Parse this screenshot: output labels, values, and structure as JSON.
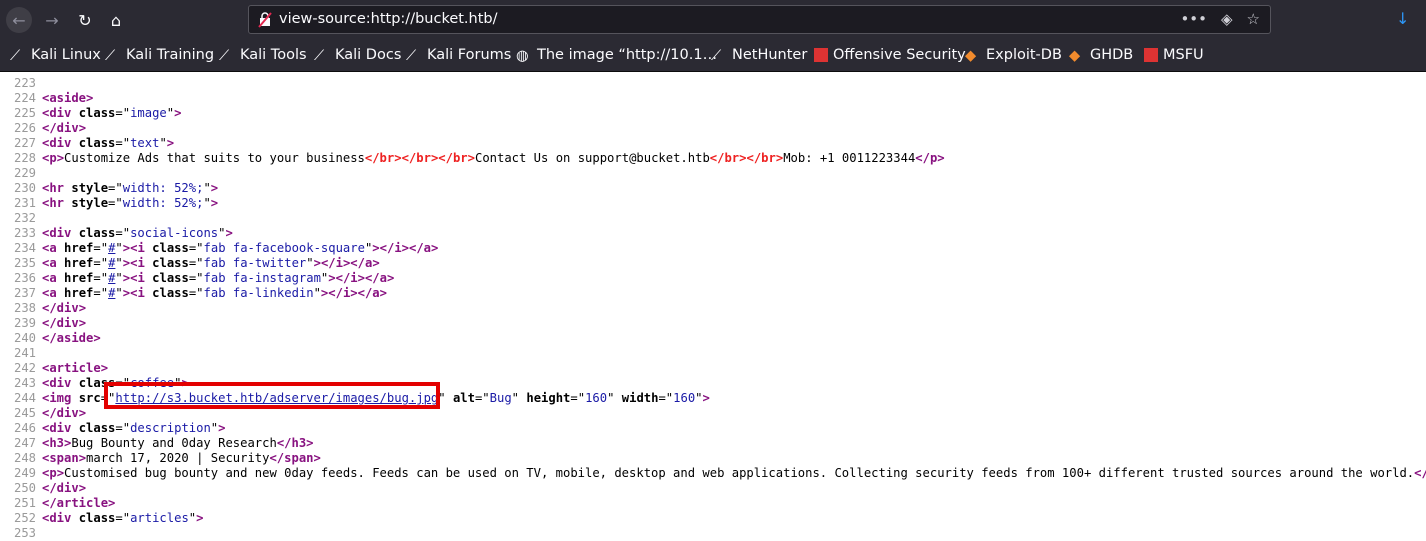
{
  "browser": {
    "url": "view-source:http://bucket.htb/",
    "bookmarks": [
      "Kali Linux",
      "Kali Training",
      "Kali Tools",
      "Kali Docs",
      "Kali Forums",
      "The image “http://10.1…",
      "NetHunter",
      "Offensive Security",
      "Exploit-DB",
      "GHDB",
      "MSFU"
    ]
  },
  "source": {
    "lines": [
      {
        "n": "223",
        "code": ""
      },
      {
        "n": "224",
        "code": "<aside>"
      },
      {
        "n": "225",
        "code": "<div class=\"image\">"
      },
      {
        "n": "226",
        "code": "</div>"
      },
      {
        "n": "227",
        "code": "<div class=\"text\">"
      },
      {
        "n": "228",
        "code": "<p>Customize Ads that suits to your business</br></br></br>Contact Us on support@bucket.htb</br></br>Mob: +1 0011223344</p>"
      },
      {
        "n": "229",
        "code": ""
      },
      {
        "n": "230",
        "code": "<hr style=\"width: 52%;\">"
      },
      {
        "n": "231",
        "code": "<hr style=\"width: 52%;\">"
      },
      {
        "n": "232",
        "code": ""
      },
      {
        "n": "233",
        "code": "<div class=\"social-icons\">"
      },
      {
        "n": "234",
        "code": "<a href=\"#\"><i class=\"fab fa-facebook-square\"></i></a>"
      },
      {
        "n": "235",
        "code": "<a href=\"#\"><i class=\"fab fa-twitter\"></i></a>"
      },
      {
        "n": "236",
        "code": "<a href=\"#\"><i class=\"fab fa-instagram\"></i></a>"
      },
      {
        "n": "237",
        "code": "<a href=\"#\"><i class=\"fab fa-linkedin\"></i></a>"
      },
      {
        "n": "238",
        "code": "</div>"
      },
      {
        "n": "239",
        "code": "</div>"
      },
      {
        "n": "240",
        "code": "</aside>"
      },
      {
        "n": "241",
        "code": ""
      },
      {
        "n": "242",
        "code": "<article>"
      },
      {
        "n": "243",
        "code": "<div class=\"coffee\">"
      },
      {
        "n": "244",
        "code": "<img src=\"http://s3.bucket.htb/adserver/images/bug.jpg\" alt=\"Bug\" height=\"160\" width=\"160\">"
      },
      {
        "n": "245",
        "code": "</div>"
      },
      {
        "n": "246",
        "code": "<div class=\"description\">"
      },
      {
        "n": "247",
        "code": "<h3>Bug Bounty and 0day Research</h3>"
      },
      {
        "n": "248",
        "code": "<span>march 17, 2020 | Security</span>"
      },
      {
        "n": "249",
        "code": "<p>Customised bug bounty and new 0day feeds. Feeds can be used on TV, mobile, desktop and web applications. Collecting security feeds from 100+ different trusted sources around the world.</p>"
      },
      {
        "n": "250",
        "code": "</div>"
      },
      {
        "n": "251",
        "code": "</article>"
      },
      {
        "n": "252",
        "code": "<div class=\"articles\">"
      },
      {
        "n": "253",
        "code": ""
      }
    ]
  }
}
